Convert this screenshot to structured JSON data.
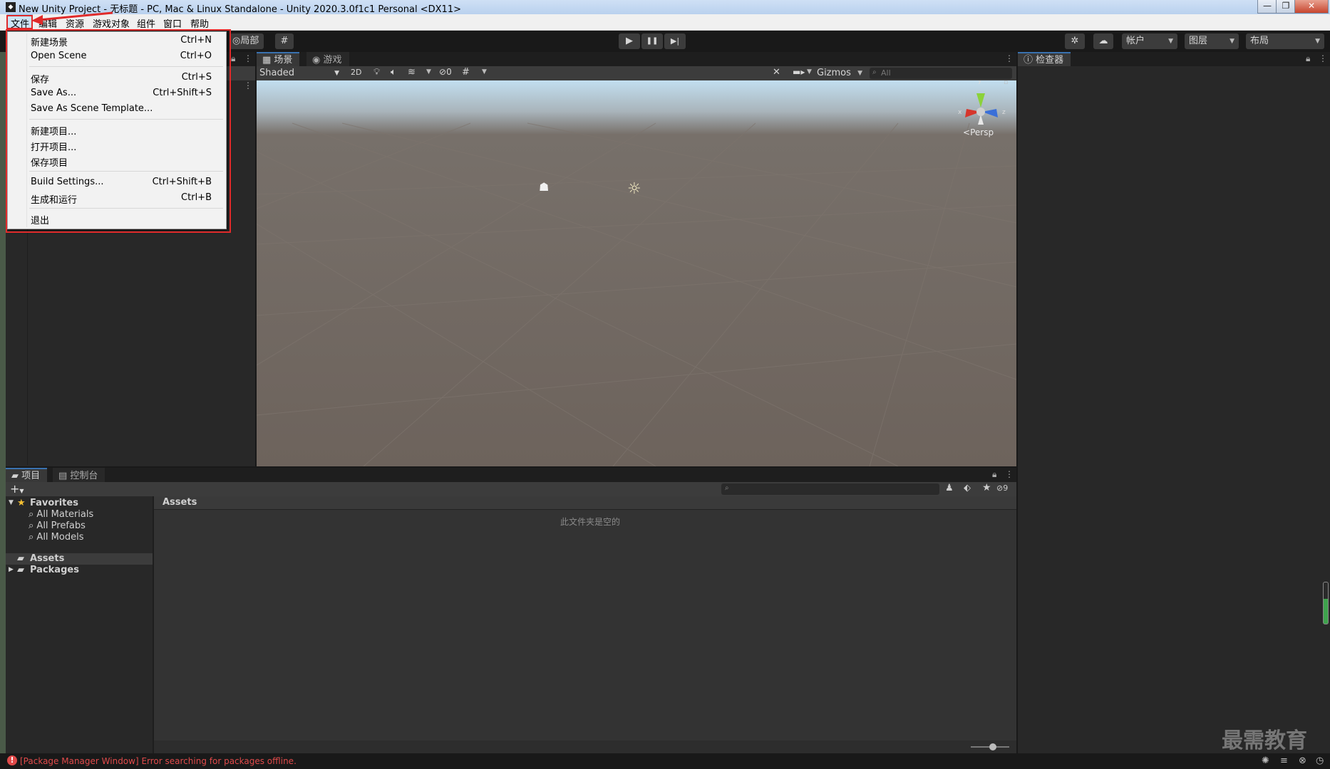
{
  "window": {
    "title": "New Unity Project - 无标题 - PC, Mac & Linux Standalone - Unity 2020.3.0f1c1 Personal <DX11>",
    "app_icon": "unity-icon",
    "minimize_glyph": "—",
    "restore_glyph": "❐",
    "close_glyph": "✕"
  },
  "menubar": {
    "items": [
      "文件",
      "编辑",
      "资源",
      "游戏对象",
      "组件",
      "窗口",
      "帮助"
    ]
  },
  "file_menu": {
    "items": [
      {
        "label": "新建场景",
        "shortcut": "Ctrl+N"
      },
      {
        "label": "Open Scene",
        "shortcut": "Ctrl+O"
      },
      {
        "label": "保存",
        "shortcut": "Ctrl+S"
      },
      {
        "label": "Save As...",
        "shortcut": "Ctrl+Shift+S"
      },
      {
        "label": "Save As Scene Template...",
        "shortcut": ""
      },
      {
        "label": "新建项目...",
        "shortcut": ""
      },
      {
        "label": "打开项目...",
        "shortcut": ""
      },
      {
        "label": "保存项目",
        "shortcut": ""
      },
      {
        "label": "Build Settings...",
        "shortcut": "Ctrl+Shift+B"
      },
      {
        "label": "生成和运行",
        "shortcut": "Ctrl+B"
      },
      {
        "label": "退出",
        "shortcut": ""
      }
    ]
  },
  "toolbar": {
    "pivot_label": "局部",
    "account_label": "帐户",
    "layers_label": "图层",
    "layout_label": "布局",
    "play_glyph": "▶",
    "pause_glyph": "❚❚",
    "step_glyph": "▶|"
  },
  "scene_panel": {
    "tabs": [
      "场景",
      "游戏"
    ],
    "shading_mode": "Shaded",
    "mode_2d": "2D",
    "hidden_count": "0",
    "gizmos_label": "Gizmos",
    "search_placeholder": "All",
    "persp_label": "Persp",
    "axis_x": "x",
    "axis_y": "y",
    "axis_z": "z"
  },
  "inspector": {
    "tab": "检查器"
  },
  "project_panel": {
    "tabs": [
      "项目",
      "控制台"
    ],
    "add_label": "+",
    "favorites_label": "Favorites",
    "favorites": [
      "All Materials",
      "All Prefabs",
      "All Models"
    ],
    "roots": [
      "Assets",
      "Packages"
    ],
    "breadcrumb": "Assets",
    "empty_message": "此文件夹是空的",
    "hidden_packages_count": "9"
  },
  "status": {
    "message": "[Package Manager Window] Error searching for packages offline."
  },
  "watermark": "最需教育",
  "colors": {
    "accent_red": "#e02a2a",
    "status_error": "#e04a4a",
    "tab_highlight": "#3a72b0"
  }
}
